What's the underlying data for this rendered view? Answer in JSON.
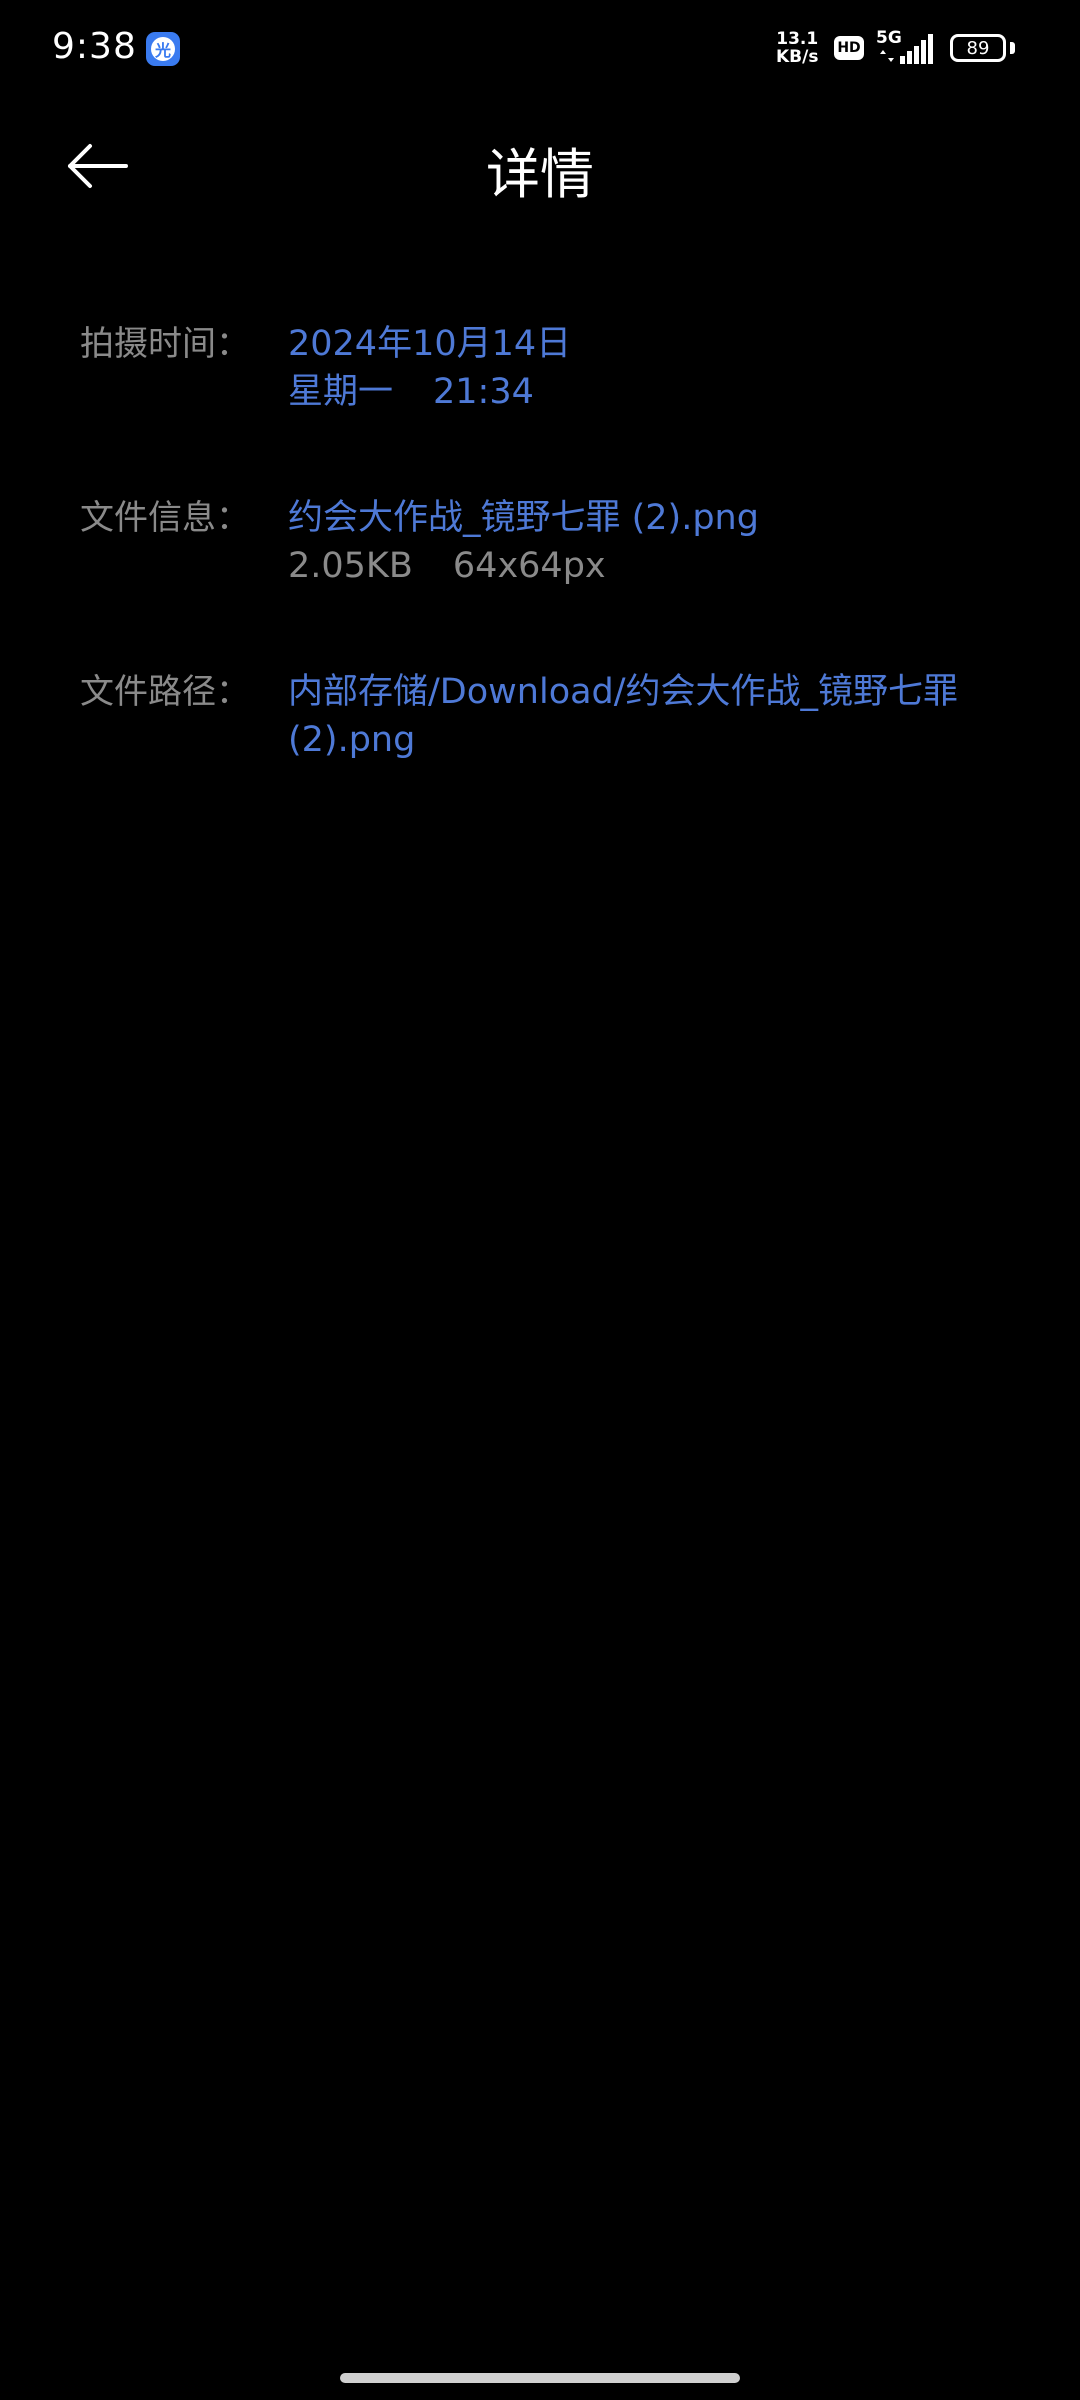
{
  "status_bar": {
    "time": "9:38",
    "app_badge_glyph": "光",
    "net_speed_value": "13.1",
    "net_speed_unit": "KB/s",
    "hd_label": "HD",
    "network_type": "5G",
    "battery_level": "89"
  },
  "header": {
    "title": "详情",
    "back_icon": "arrow-left-icon"
  },
  "details": {
    "capture_time": {
      "label": "拍摄时间：",
      "date": "2024年10月14日",
      "weekday": "星期一",
      "time": "21:34"
    },
    "file_info": {
      "label": "文件信息：",
      "file_name": "约会大作战_镜野七罪 (2).png",
      "size": "2.05KB",
      "dimensions": "64x64px"
    },
    "file_path": {
      "label": "文件路径：",
      "path_line1": "内部存储/Download/约会大作战_镜野七罪",
      "path_line2": "(2).png"
    }
  },
  "colors": {
    "background": "#000000",
    "accent": "#4e79d6",
    "label": "#8a8a8a",
    "text": "#ffffff"
  }
}
